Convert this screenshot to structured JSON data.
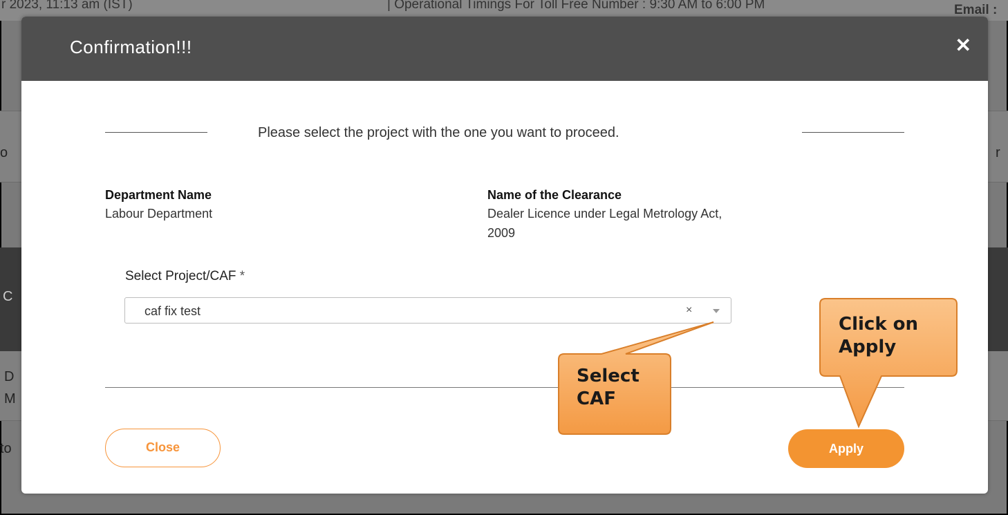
{
  "background": {
    "topbar_date": "r 2023, 11:13 am (IST)",
    "topbar_middle": "| Operational Timings For Toll Free Number : 9:30 AM to 6:00 PM",
    "topbar_email": "Email :",
    "fragments": [
      "o",
      "C",
      "D",
      "M",
      "to",
      "r"
    ]
  },
  "modal": {
    "title": "Confirmation!!!",
    "close_icon": "close-icon",
    "instruction": "Please select the project with the one you want to proceed.",
    "department_label": "Department Name",
    "department_value": "Labour Department",
    "clearance_label": "Name of the Clearance",
    "clearance_value_line1": "Dealer Licence under Legal Metrology Act,",
    "clearance_value_line2": "2009",
    "select_label": "Select Project/CAF",
    "required_mark": "*",
    "select_value": "caf fix test",
    "clear_glyph": "×",
    "close_button": "Close",
    "apply_button": "Apply"
  },
  "callouts": {
    "select_caf_line1": "Select",
    "select_caf_line2": "CAF",
    "apply_line1": "Click on",
    "apply_line2": "Apply"
  },
  "colors": {
    "accent": "#f39431",
    "header": "#4f4f4f",
    "callout_fill": "#f7a34e"
  }
}
